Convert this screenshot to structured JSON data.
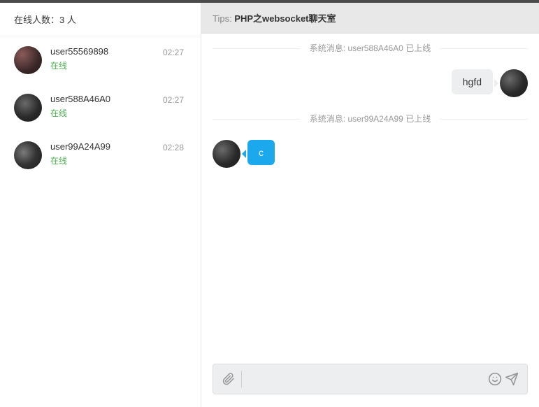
{
  "sidebar": {
    "online_label": "在线人数：",
    "online_count": "3 人",
    "users": [
      {
        "name": "user55569898",
        "status": "在线",
        "time": "02:27"
      },
      {
        "name": "user588A46A0",
        "status": "在线",
        "time": "02:27"
      },
      {
        "name": "user99A24A99",
        "status": "在线",
        "time": "02:28"
      }
    ]
  },
  "header": {
    "tips_label": "Tips: ",
    "tips_title": "PHP之websocket聊天室"
  },
  "chat": {
    "sys1": "系统消息: user588A46A0 已上线",
    "msg1": "hgfd",
    "sys2": "系统消息: user99A24A99 已上线",
    "msg2": "c"
  },
  "input": {
    "placeholder": ""
  }
}
